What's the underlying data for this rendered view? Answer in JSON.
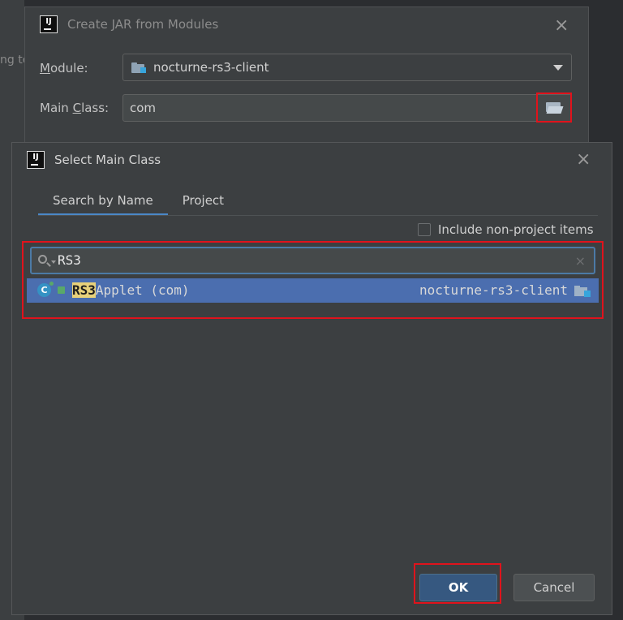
{
  "background": {
    "partial_text": "ng to"
  },
  "outer_dialog": {
    "title": "Create JAR from Modules",
    "module_label_accel": "M",
    "module_label_rest": "odule:",
    "module_value": "nocturne-rs3-client",
    "main_class_label_pre": "Main ",
    "main_class_label_accel": "C",
    "main_class_label_post": "lass:",
    "main_class_value": "com"
  },
  "inner_dialog": {
    "title": "Select Main Class",
    "tabs": [
      {
        "label": "Search by Name",
        "active": true
      },
      {
        "label": "Project",
        "active": false
      }
    ],
    "include_non_project_label": "Include non-project items",
    "include_non_project_checked": false,
    "search_value": "RS3",
    "result": {
      "match": "RS3",
      "rest": "Applet (com)",
      "module": "nocturne-rs3-client"
    },
    "ok_label": "OK",
    "cancel_label": "Cancel"
  },
  "colors": {
    "highlight_border": "#e0131c",
    "selection": "#4b6eaf",
    "primary_button": "#365880",
    "match_highlight": "#e8d17a"
  },
  "icons": [
    "intellij-logo",
    "close-icon",
    "module-folder-icon",
    "dropdown-caret-icon",
    "open-folder-icon",
    "search-icon",
    "clear-icon",
    "class-icon",
    "lock-icon"
  ]
}
